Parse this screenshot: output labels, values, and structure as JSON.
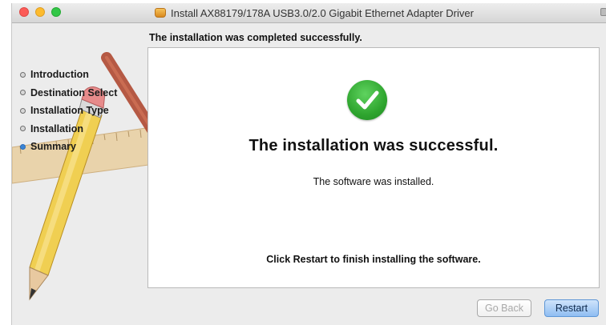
{
  "window": {
    "title": "Install AX88179/178A USB3.0/2.0 Gigabit Ethernet Adapter Driver"
  },
  "header": {
    "status": "The installation was completed successfully."
  },
  "sidebar": {
    "steps": [
      {
        "label": "Introduction",
        "active": false
      },
      {
        "label": "Destination Select",
        "active": false
      },
      {
        "label": "Installation Type",
        "active": false
      },
      {
        "label": "Installation",
        "active": false
      },
      {
        "label": "Summary",
        "active": true
      }
    ]
  },
  "main": {
    "title": "The installation was successful.",
    "subtitle": "The software was installed.",
    "footer_message": "Click Restart to finish installing the software."
  },
  "buttons": {
    "go_back": "Go Back",
    "restart": "Restart"
  },
  "colors": {
    "accent": "#3b85d6",
    "success": "#2fa52f"
  },
  "icons": [
    "close-icon",
    "minimize-icon",
    "zoom-icon",
    "package-icon",
    "lock-icon",
    "checkmark-icon",
    "pencil-icon",
    "brush-icon",
    "ruler-icon"
  ]
}
